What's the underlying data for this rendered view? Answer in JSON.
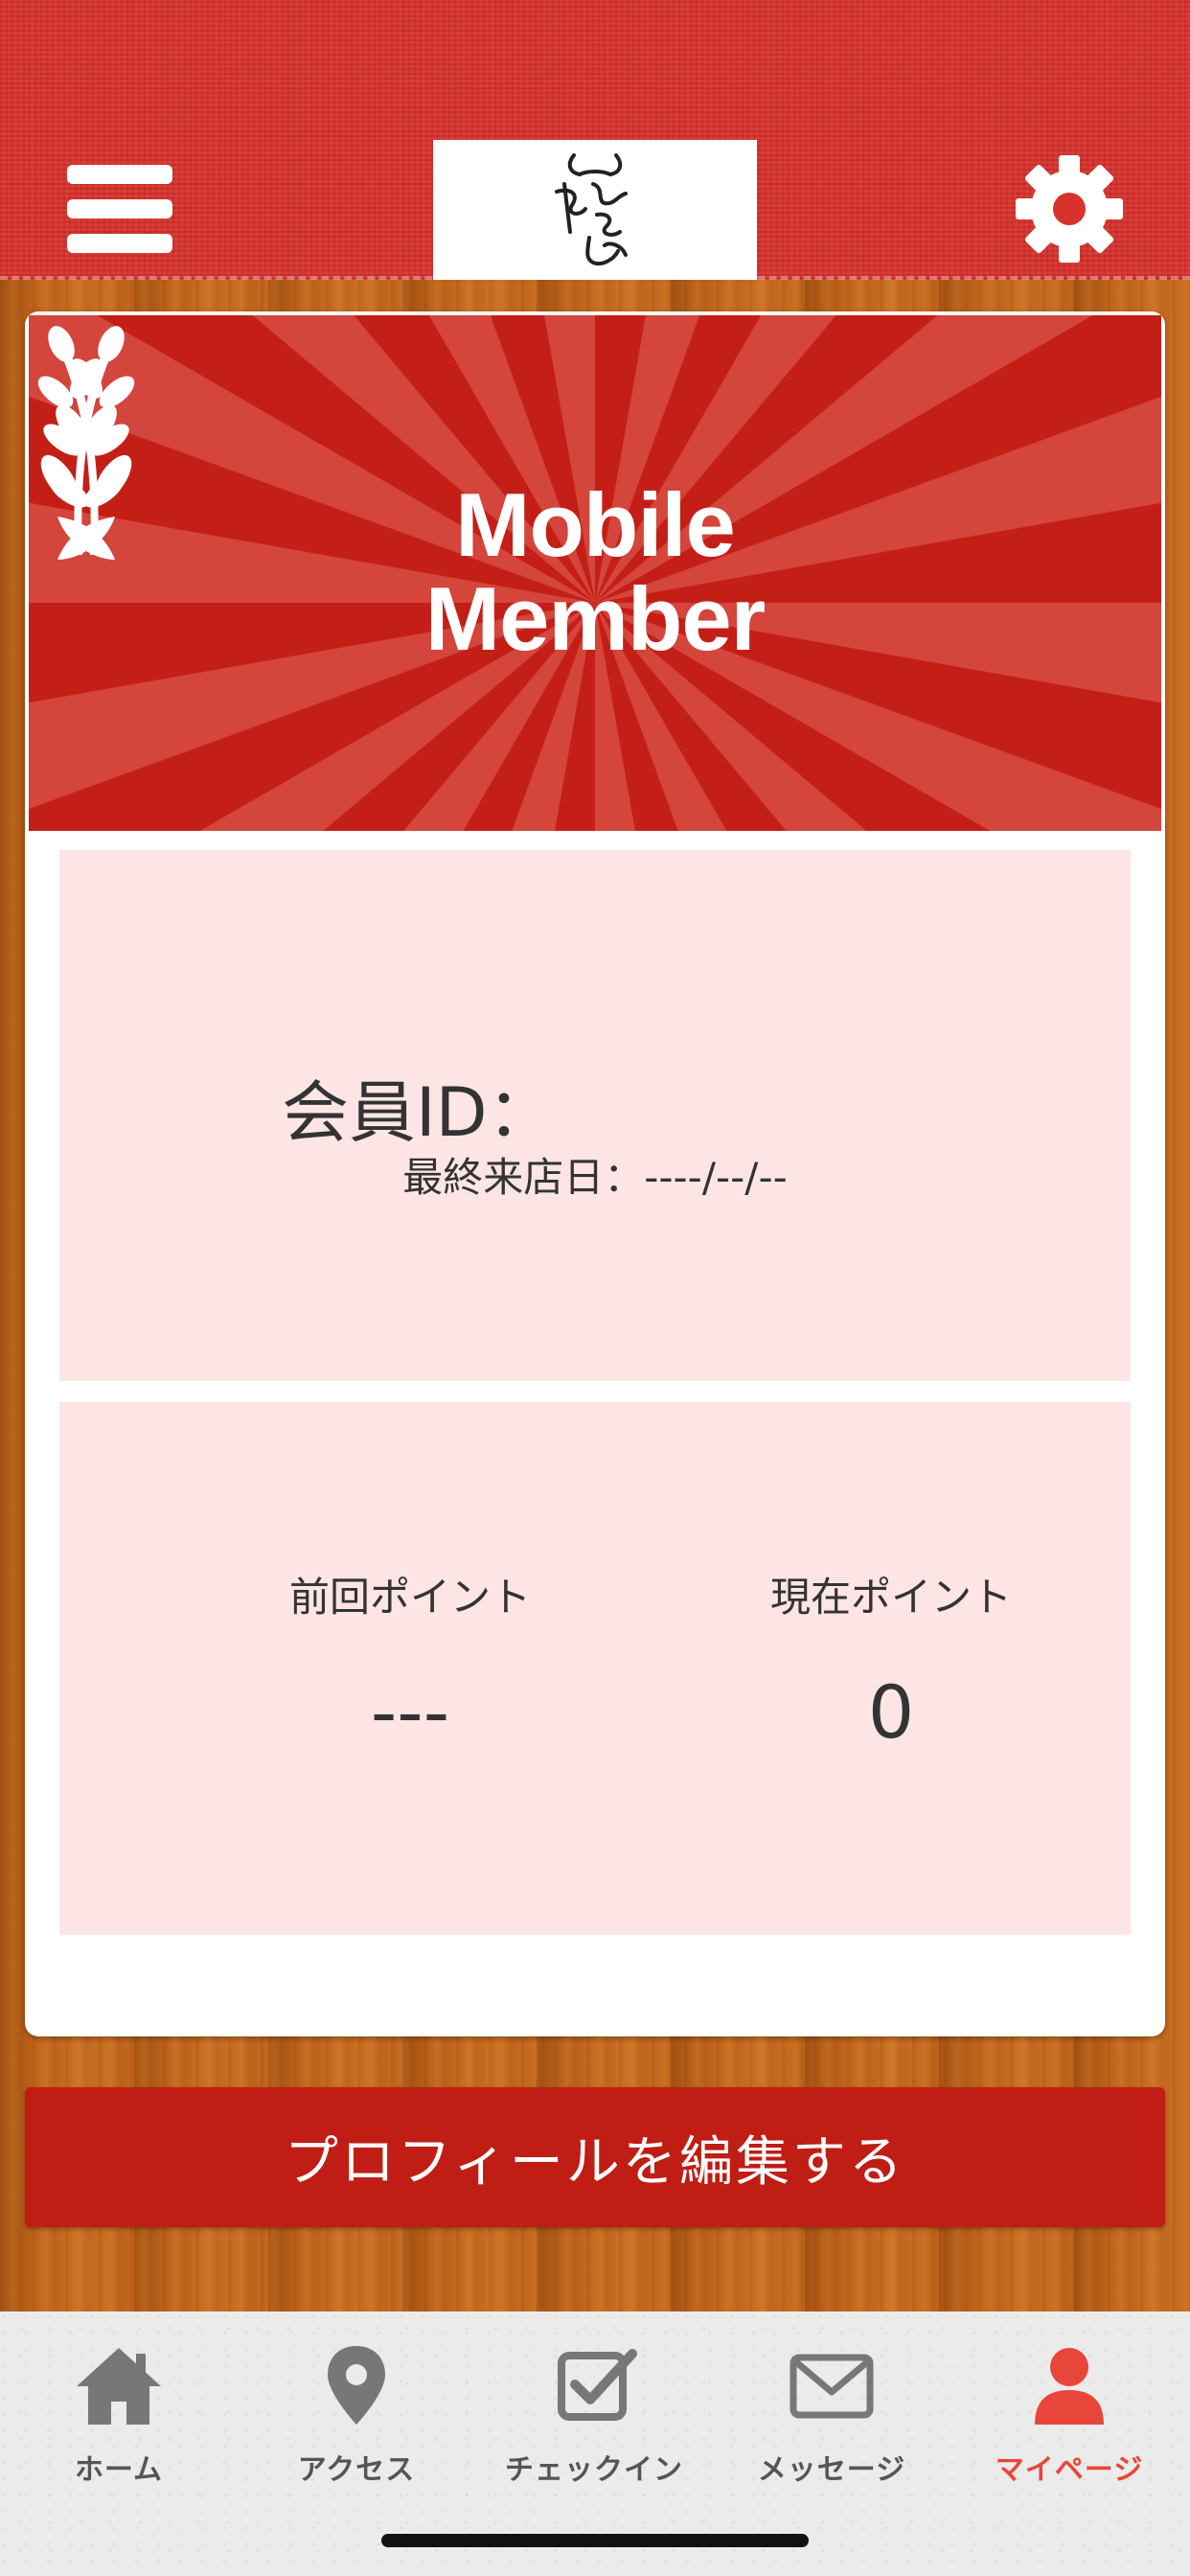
{
  "header": {
    "menu_icon": "hamburger-menu-icon",
    "logo_text": "やきにくしみず",
    "settings_icon": "gear-icon"
  },
  "banner": {
    "title_line1": "Mobile",
    "title_line2": "Member",
    "colors": {
      "red": "#c41f17",
      "ray": "#d4453c"
    }
  },
  "member": {
    "id_label": "会員ID：",
    "last_visit": "最終来店日：----/--/--"
  },
  "points": {
    "previous_label": "前回ポイント",
    "previous_value": "---",
    "current_label": "現在ポイント",
    "current_value": "0"
  },
  "actions": {
    "edit_profile": "プロフィールを編集する"
  },
  "tabs": [
    {
      "label": "ホーム",
      "icon": "house-icon"
    },
    {
      "label": "アクセス",
      "icon": "map-pin-icon"
    },
    {
      "label": "チェックイン",
      "icon": "checkbox-icon"
    },
    {
      "label": "メッセージ",
      "icon": "envelope-icon"
    },
    {
      "label": "マイページ",
      "icon": "person-icon",
      "active": true
    }
  ],
  "colors": {
    "header_red": "#d8322c",
    "button_red": "#c01d15",
    "panel_pink": "#fde5e5",
    "active_tab": "#e8463a"
  }
}
